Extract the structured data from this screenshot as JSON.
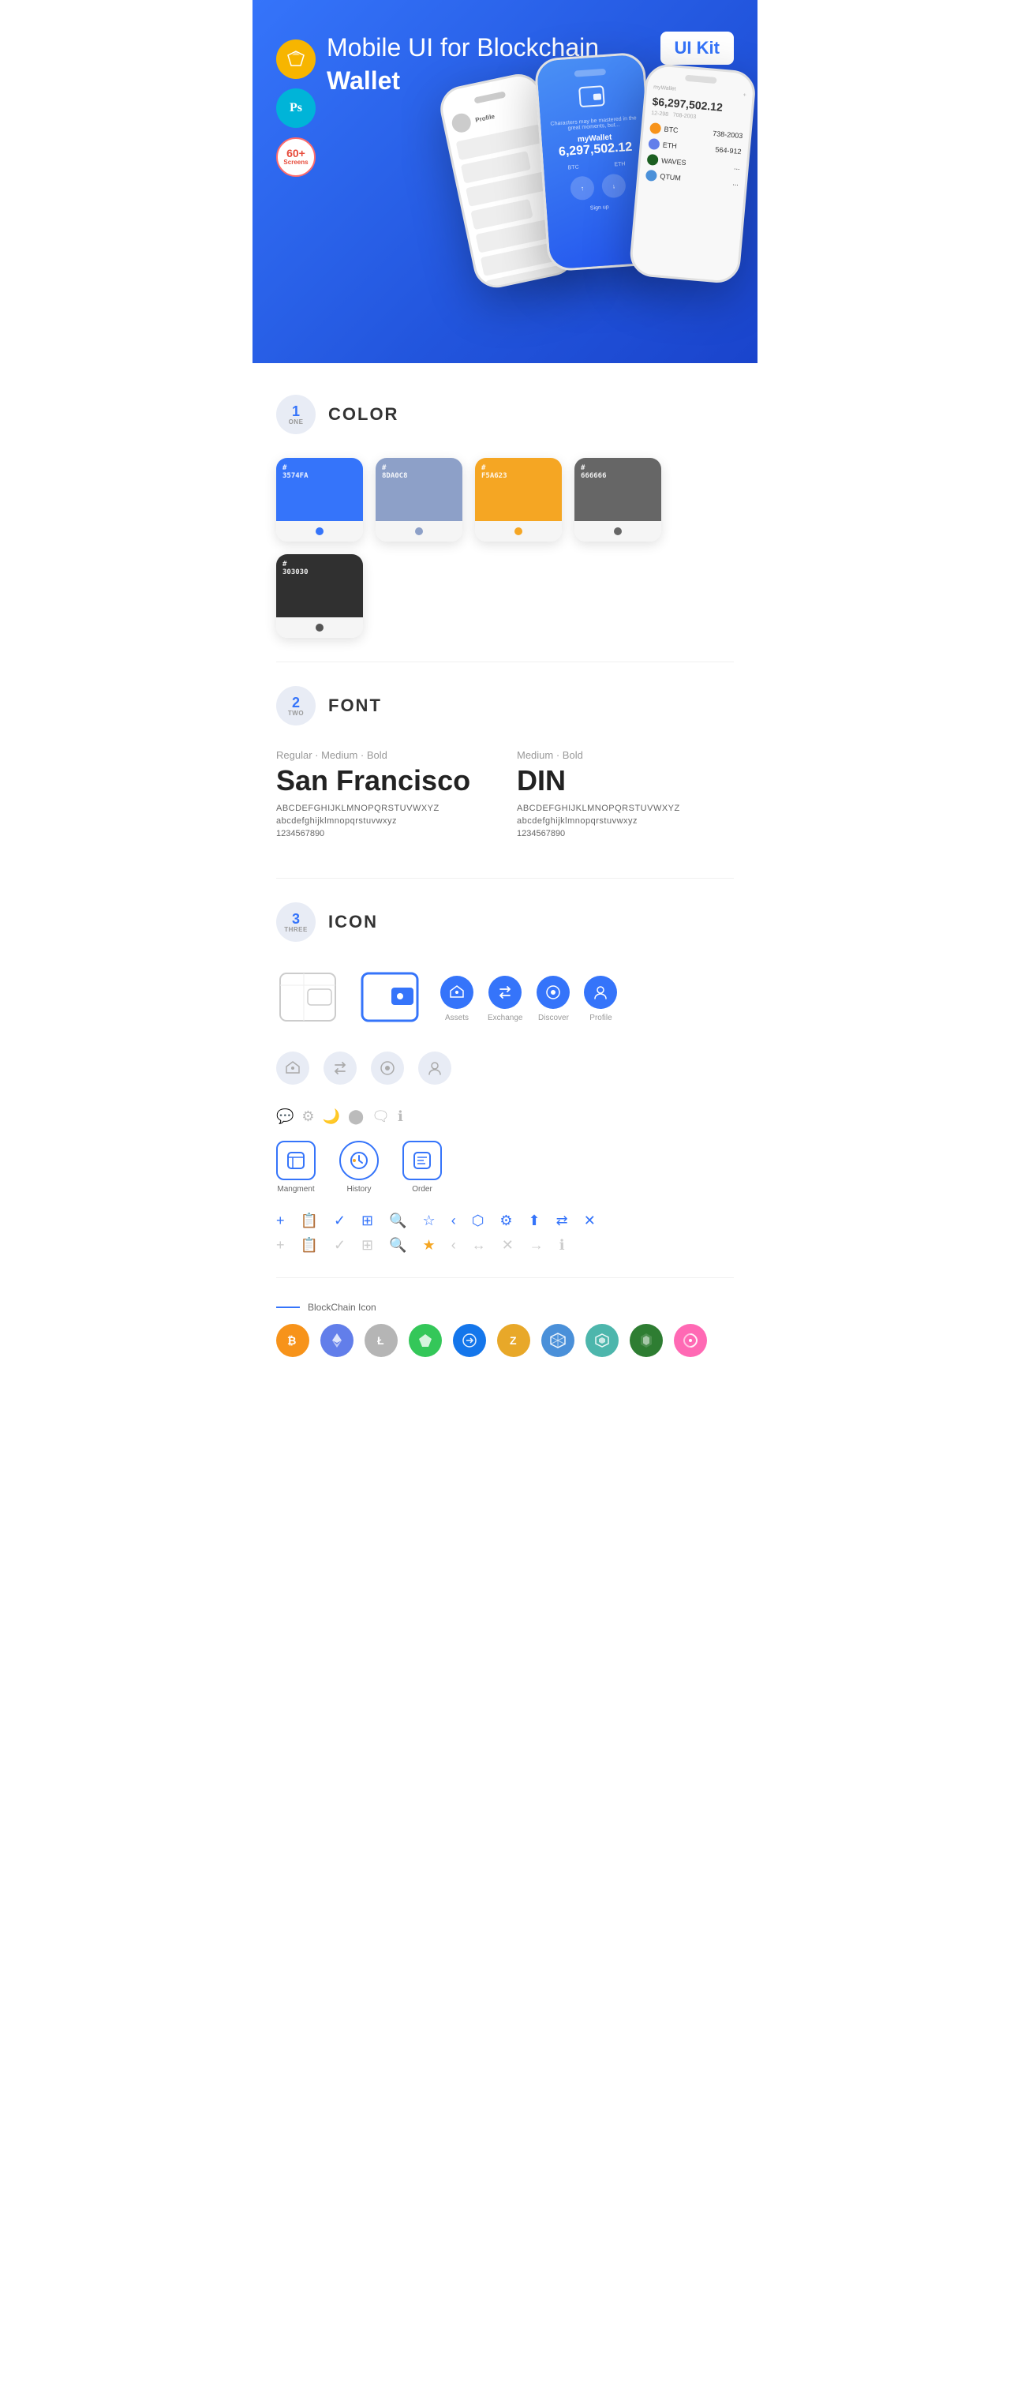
{
  "hero": {
    "title_normal": "Mobile UI for Blockchain ",
    "title_bold": "Wallet",
    "badge": "UI Kit",
    "sketch_label": "Sketch",
    "ps_label": "Ps",
    "screens_label": "60+\nScreens"
  },
  "sections": {
    "color": {
      "number": "1",
      "word": "ONE",
      "title": "COLOR",
      "swatches": [
        {
          "hex": "#3574FA",
          "label": "3574FA"
        },
        {
          "hex": "#8D A0C8",
          "label": "8DA0C8"
        },
        {
          "hex": "#F5A623",
          "label": "F5A623"
        },
        {
          "hex": "#666666",
          "label": "666666"
        },
        {
          "hex": "#303030",
          "label": "303030"
        }
      ]
    },
    "font": {
      "number": "2",
      "word": "TWO",
      "title": "FONT",
      "font1": {
        "label": "Regular · Medium · Bold",
        "name": "San Francisco",
        "upper": "ABCDEFGHIJKLMNOPQRSTUVWXYZ",
        "lower": "abcdefghijklmnopqrstuvwxyz",
        "nums": "1234567890"
      },
      "font2": {
        "label": "Medium · Bold",
        "name": "DIN",
        "upper": "ABCDEFGHIJKLMNOPQRSTUVWXYZ",
        "lower": "abcdefghijklmnopqrstuvwxyz",
        "nums": "1234567890"
      }
    },
    "icon": {
      "number": "3",
      "word": "THREE",
      "title": "ICON",
      "nav_icons": [
        {
          "label": "Assets"
        },
        {
          "label": "Exchange"
        },
        {
          "label": "Discover"
        },
        {
          "label": "Profile"
        }
      ],
      "main_icons": [
        {
          "label": "Mangment"
        },
        {
          "label": "History"
        },
        {
          "label": "Order"
        }
      ],
      "blockchain_label": "BlockChain Icon",
      "cryptos": [
        {
          "color": "#F7931A",
          "symbol": "₿"
        },
        {
          "color": "#627EEA",
          "symbol": "Ξ"
        },
        {
          "color": "#B5B5B5",
          "symbol": "Ł"
        },
        {
          "color": "#34C759",
          "symbol": "◆"
        },
        {
          "color": "#1476EB",
          "symbol": "Đ"
        },
        {
          "color": "#A8A8A8",
          "symbol": "ℤ"
        },
        {
          "color": "#4A90D9",
          "symbol": "⬡"
        },
        {
          "color": "#4DB6AC",
          "symbol": "◈"
        },
        {
          "color": "#1B5E20",
          "symbol": "◆"
        },
        {
          "color": "#FF69B4",
          "symbol": "∞"
        }
      ]
    }
  }
}
